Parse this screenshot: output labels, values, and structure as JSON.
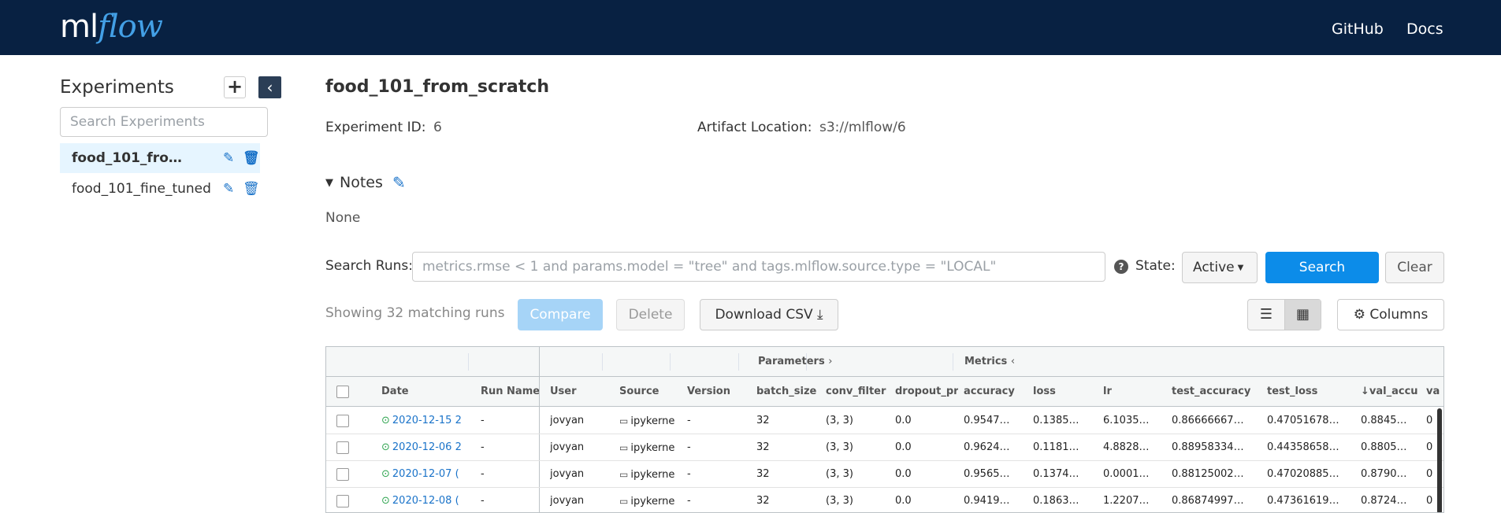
{
  "header": {
    "logo_ml": "ml",
    "logo_flow": "flow",
    "nav": [
      "GitHub",
      "Docs"
    ]
  },
  "sidebar": {
    "title": "Experiments",
    "add_label": "+",
    "search_placeholder": "Search Experiments",
    "experiments": [
      {
        "name": "food_101_from_scratch",
        "active": true
      },
      {
        "name": "food_101_fine_tuned",
        "active": false
      }
    ]
  },
  "experiment": {
    "title": "food_101_from_scratch",
    "id_label": "Experiment ID:",
    "id_value": "6",
    "artifact_label": "Artifact Location:",
    "artifact_value": "s3://mlflow/6",
    "notes_label": "Notes",
    "notes_value": "None"
  },
  "search": {
    "label": "Search Runs:",
    "placeholder": "metrics.rmse < 1 and params.model = \"tree\" and tags.mlflow.source.type = \"LOCAL\"",
    "state_label": "State:",
    "state_value": "Active",
    "search_button": "Search",
    "clear_button": "Clear"
  },
  "toolbar": {
    "showing": "Showing 32 matching runs",
    "compare": "Compare",
    "delete": "Delete",
    "download_csv": "Download CSV",
    "columns": "Columns"
  },
  "table": {
    "groups": {
      "parameters": "Parameters",
      "metrics": "Metrics"
    },
    "headers": {
      "date": "Date",
      "run_name": "Run Name",
      "user": "User",
      "source": "Source",
      "version": "Version",
      "batch_size": "batch_size",
      "conv_filter": "conv_filter",
      "dropout": "dropout_pr",
      "accuracy": "accuracy",
      "loss": "loss",
      "lr": "lr",
      "test_accuracy": "test_accuracy",
      "test_loss": "test_loss",
      "val_accuracy": "val_accu",
      "val_loss": "va"
    },
    "rows": [
      {
        "date": "2020-12-15 2",
        "run_name": "-",
        "user": "jovyan",
        "source": "ipykerne",
        "version": "-",
        "batch_size": "32",
        "conv_filter": "(3, 3)",
        "dropout": "0.0",
        "accuracy": "0.9547…",
        "loss": "0.1385…",
        "lr": "6.1035…",
        "test_accuracy": "0.86666667…",
        "test_loss": "0.47051678…",
        "val_accuracy": "0.8845…",
        "val_loss": "0"
      },
      {
        "date": "2020-12-06 2",
        "run_name": "-",
        "user": "jovyan",
        "source": "ipykerne",
        "version": "-",
        "batch_size": "32",
        "conv_filter": "(3, 3)",
        "dropout": "0.0",
        "accuracy": "0.9624…",
        "loss": "0.1181…",
        "lr": "4.8828…",
        "test_accuracy": "0.88958334…",
        "test_loss": "0.44358658…",
        "val_accuracy": "0.8805…",
        "val_loss": "0"
      },
      {
        "date": "2020-12-07 (",
        "run_name": "-",
        "user": "jovyan",
        "source": "ipykerne",
        "version": "-",
        "batch_size": "32",
        "conv_filter": "(3, 3)",
        "dropout": "0.0",
        "accuracy": "0.9565…",
        "loss": "0.1374…",
        "lr": "0.0001…",
        "test_accuracy": "0.88125002…",
        "test_loss": "0.47020885…",
        "val_accuracy": "0.8790…",
        "val_loss": "0"
      },
      {
        "date": "2020-12-08 (",
        "run_name": "-",
        "user": "jovyan",
        "source": "ipykerne",
        "version": "-",
        "batch_size": "32",
        "conv_filter": "(3, 3)",
        "dropout": "0.0",
        "accuracy": "0.9419…",
        "loss": "0.1863…",
        "lr": "1.2207…",
        "test_accuracy": "0.86874997…",
        "test_loss": "0.47361619…",
        "val_accuracy": "0.8724…",
        "val_loss": "0"
      }
    ]
  },
  "colors": {
    "header_bg": "#082142",
    "accent": "#0c8ce9",
    "logo_flow": "#43a0e6"
  }
}
